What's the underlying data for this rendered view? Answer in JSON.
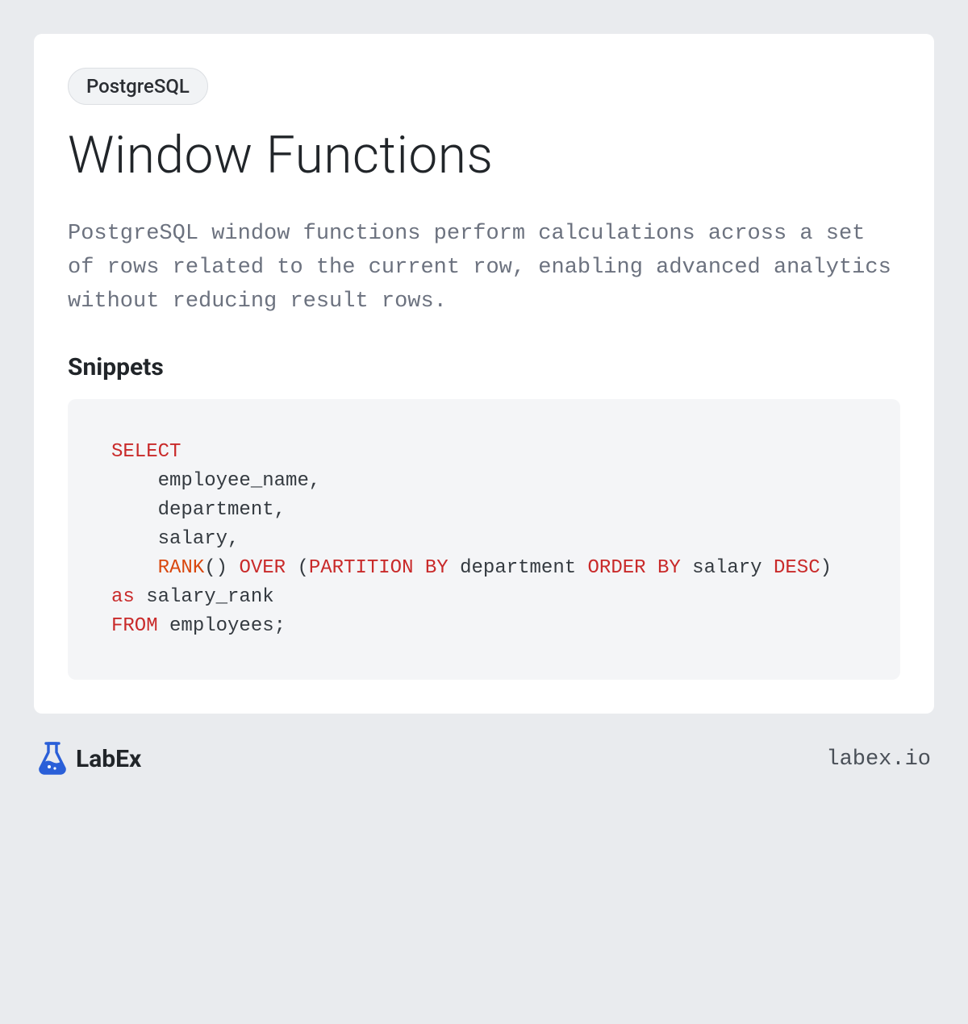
{
  "tag": "PostgreSQL",
  "title": "Window Functions",
  "description": "PostgreSQL window functions perform calculations across a set of rows related to the current row, enabling advanced analytics without reducing result rows.",
  "section_heading": "Snippets",
  "code": {
    "tokens": [
      {
        "t": "SELECT",
        "c": "kw-red"
      },
      {
        "t": "\n    employee_name,\n    department,\n    salary,\n    "
      },
      {
        "t": "RANK",
        "c": "kw-orange"
      },
      {
        "t": "() "
      },
      {
        "t": "OVER",
        "c": "kw-red"
      },
      {
        "t": " ("
      },
      {
        "t": "PARTITION",
        "c": "kw-red"
      },
      {
        "t": " "
      },
      {
        "t": "BY",
        "c": "kw-red"
      },
      {
        "t": " department "
      },
      {
        "t": "ORDER",
        "c": "kw-red"
      },
      {
        "t": " "
      },
      {
        "t": "BY",
        "c": "kw-red"
      },
      {
        "t": " salary "
      },
      {
        "t": "DESC",
        "c": "kw-red"
      },
      {
        "t": ") "
      },
      {
        "t": "as",
        "c": "kw-red"
      },
      {
        "t": " salary_rank\n"
      },
      {
        "t": "FROM",
        "c": "kw-red"
      },
      {
        "t": " employees;"
      }
    ]
  },
  "brand": "LabEx",
  "domain": "labex.io"
}
